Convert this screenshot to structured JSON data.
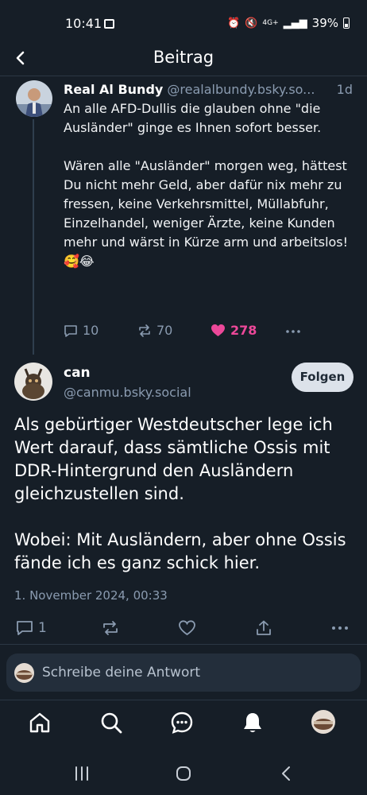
{
  "status": {
    "time": "10:41",
    "signal": "4G+",
    "battery": "39%"
  },
  "header": {
    "title": "Beitrag"
  },
  "parent_post": {
    "author_name": "Real Al Bundy",
    "author_handle": "@realalbundy.bsky.so...",
    "time_ago": "1d",
    "text": "An alle AFD-Dullis die glauben ohne \"die Ausländer\" ginge es Ihnen sofort besser.\n\nWären alle \"Ausländer\" morgen weg, hättest Du nicht mehr Geld, aber dafür nix mehr zu fressen, keine Verkehrsmittel, Müllabfuhr, Einzelhandel, weniger Ärzte, keine Kunden mehr und wärst in Kürze arm und arbeitslos! 🥰😂",
    "replies": "10",
    "reposts": "70",
    "likes": "278",
    "like_color": "#ec4899"
  },
  "main_post": {
    "author_name": "can",
    "author_handle": "@canmu.bsky.social",
    "follow_label": "Folgen",
    "text": "Als gebürtiger Westdeutscher lege ich Wert darauf, dass sämtliche Ossis mit DDR-Hintergrund den Ausländern gleichzustellen sind.\n\nWobei: Mit Ausländern, aber ohne Ossis fände ich es ganz schick hier.",
    "date": "1. November 2024, 00:33",
    "replies": "1"
  },
  "composer": {
    "placeholder": "Schreibe deine Antwort"
  },
  "nav": {
    "items": [
      "home-icon",
      "search-icon",
      "chat-icon",
      "bell-icon",
      "profile-avatar"
    ]
  },
  "colors": {
    "background": "#161e27",
    "muted": "#8a9bb0",
    "accent_like": "#ec4899"
  }
}
